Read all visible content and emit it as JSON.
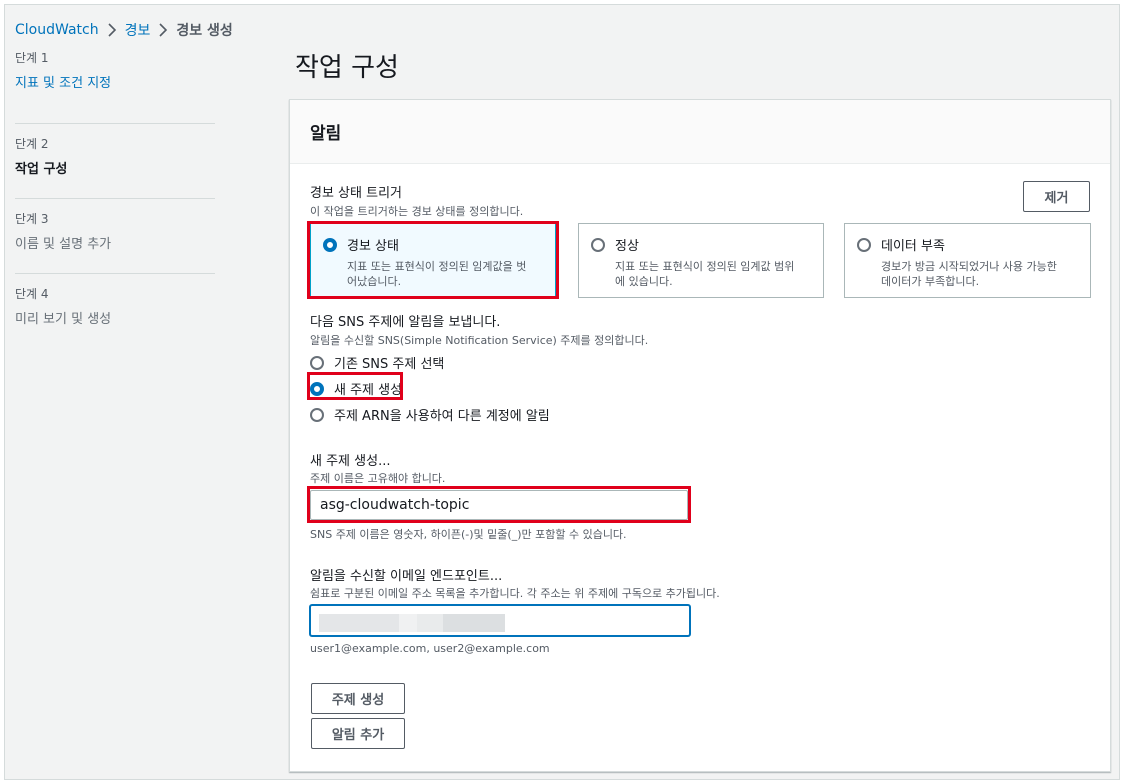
{
  "breadcrumb": [
    "CloudWatch",
    "경보",
    "경보 생성"
  ],
  "steps": [
    {
      "label": "단계 1",
      "title": "지표 및 조건 지정",
      "state": "link"
    },
    {
      "label": "단계 2",
      "title": "작업 구성",
      "state": "current"
    },
    {
      "label": "단계 3",
      "title": "이름 및 설명 추가",
      "state": "disabled"
    },
    {
      "label": "단계 4",
      "title": "미리 보기 및 생성",
      "state": "disabled"
    }
  ],
  "page_title": "작업 구성",
  "panel": {
    "title": "알림",
    "remove_button": "제거",
    "trigger": {
      "label": "경보 상태 트리거",
      "description": "이 작업을 트리거하는 경보 상태를 정의합니다.",
      "options": [
        {
          "title": "경보 상태",
          "desc_line1": "지표 또는 표현식이 정의된 임계값을 벗",
          "desc_line2": "어났습니다.",
          "selected": true
        },
        {
          "title": "정상",
          "desc_line1": "지표 또는 표현식이 정의된 임계값 범위",
          "desc_line2": "에 있습니다.",
          "selected": false
        },
        {
          "title": "데이터 부족",
          "desc_line1": "경보가 방금 시작되었거나 사용 가능한",
          "desc_line2": "데이터가 부족합니다.",
          "selected": false
        }
      ]
    },
    "sns": {
      "label": "다음 SNS 주제에 알림을 보냅니다.",
      "description": "알림을 수신할 SNS(Simple Notification Service) 주제를 정의합니다.",
      "options": [
        {
          "label": "기존 SNS 주제 선택",
          "selected": false
        },
        {
          "label": "새 주제 생성",
          "selected": true
        },
        {
          "label": "주제 ARN을 사용하여 다른 계정에 알림",
          "selected": false
        }
      ]
    },
    "new_topic": {
      "label": "새 주제 생성...",
      "description": "주제 이름은 고유해야 합니다.",
      "value": "asg-cloudwatch-topic",
      "constraint": "SNS 주제 이름은 영숫자, 하이픈(-)및 밑줄(_)만 포함할 수 있습니다."
    },
    "email": {
      "label": "알림을 수신할 이메일 엔드포인트...",
      "description": "쉼표로 구분된 이메일 주소 목록을 추가합니다. 각 주소는 위 주제에 구독으로 추가됩니다.",
      "hint": "user1@example.com, user2@example.com"
    },
    "create_topic_button": "주제 생성",
    "add_notification_button": "알림 추가"
  },
  "colors": {
    "link": "#0073bb",
    "highlight": "#e0001b",
    "selected_tile_bg": "#f1faff"
  }
}
